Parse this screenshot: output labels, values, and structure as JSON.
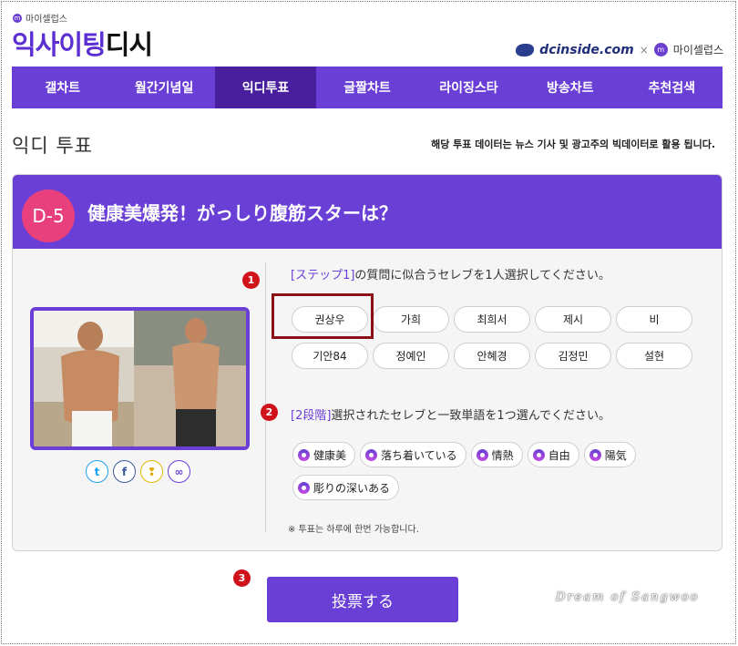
{
  "brand": {
    "small_label": "마이셀럽스",
    "logo_main": "익사이팅",
    "logo_tail": "디시",
    "partner_dc": "dcinside.com",
    "partner_sep": "×",
    "partner_two": "마이셀럽스"
  },
  "nav": {
    "items": [
      {
        "label": "갤차트"
      },
      {
        "label": "월간기념일"
      },
      {
        "label": "익디투표"
      },
      {
        "label": "글짤차트"
      },
      {
        "label": "라이징스타"
      },
      {
        "label": "방송차트"
      },
      {
        "label": "추천검색"
      }
    ],
    "active_index": 2
  },
  "page": {
    "title": "익디 투표",
    "notice": "해당 투표 데이터는 뉴스 기사 및 광고주의 빅데이터로 활용 됩니다."
  },
  "poll": {
    "dday": "D-5",
    "question": "健康美爆発！がっしり腹筋スターは？",
    "step1_tag": "[ステップ1]",
    "step1_text": "の質問に似合うセレブを1人選択してください。",
    "step2_tag": "[2段階]",
    "step2_text": "選択されたセレブと一致単語を1つ選んでください。",
    "celebs": [
      "권상우",
      "가희",
      "최희서",
      "제시",
      "비",
      "기안84",
      "정예인",
      "안혜경",
      "김정민",
      "설현"
    ],
    "selected_celeb": "권상우",
    "keywords": [
      "健康美",
      "落ち着いている",
      "情熱",
      "自由",
      "陽気",
      "彫りの深いある"
    ],
    "note": "※ 투표는 하루에 한번 가능합니다.",
    "vote_label": "投票する"
  },
  "annotations": {
    "step1": "1",
    "step2": "2",
    "step3": "3"
  },
  "share": {
    "twitter": "t",
    "facebook": "f",
    "kakao": "❢",
    "link": "∞"
  },
  "watermark": "Dream of Sangwoo",
  "colors": {
    "accent": "#6a3fd6",
    "nav_active": "#4a1f9e",
    "dday": "#e8407c",
    "annotation": "#d0121b"
  }
}
